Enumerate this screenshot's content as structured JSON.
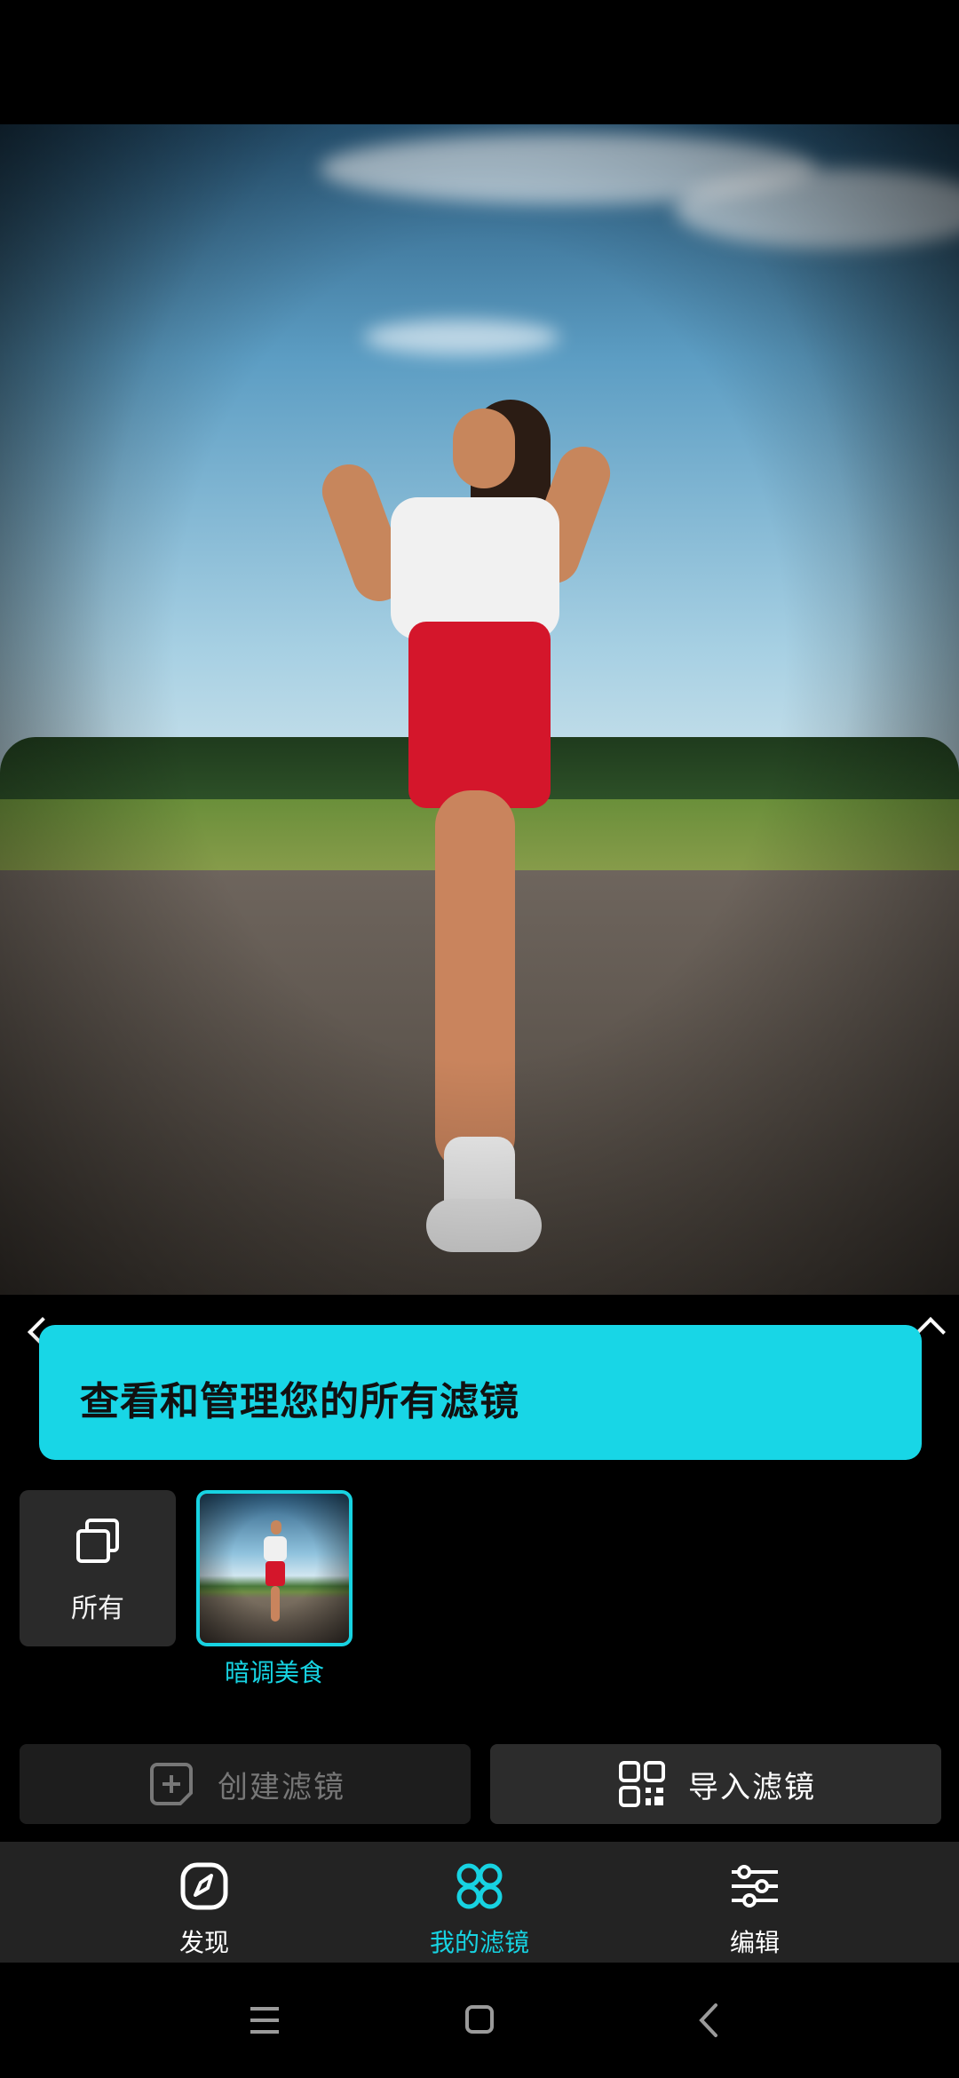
{
  "tooltip": {
    "text": "查看和管理您的所有滤镜"
  },
  "filters": {
    "all_label": "所有",
    "items": [
      {
        "label": "暗调美食",
        "selected": true
      }
    ]
  },
  "actions": {
    "create_label": "创建滤镜",
    "import_label": "导入滤镜"
  },
  "bottom_nav": {
    "items": [
      {
        "label": "发现",
        "icon": "compass-icon",
        "active": false
      },
      {
        "label": "我的滤镜",
        "icon": "grid-icon",
        "active": true
      },
      {
        "label": "编辑",
        "icon": "sliders-icon",
        "active": false
      }
    ]
  },
  "colors": {
    "accent": "#17d3e2",
    "tooltip_bg": "#18d6e6",
    "nav_bg": "#232323"
  }
}
